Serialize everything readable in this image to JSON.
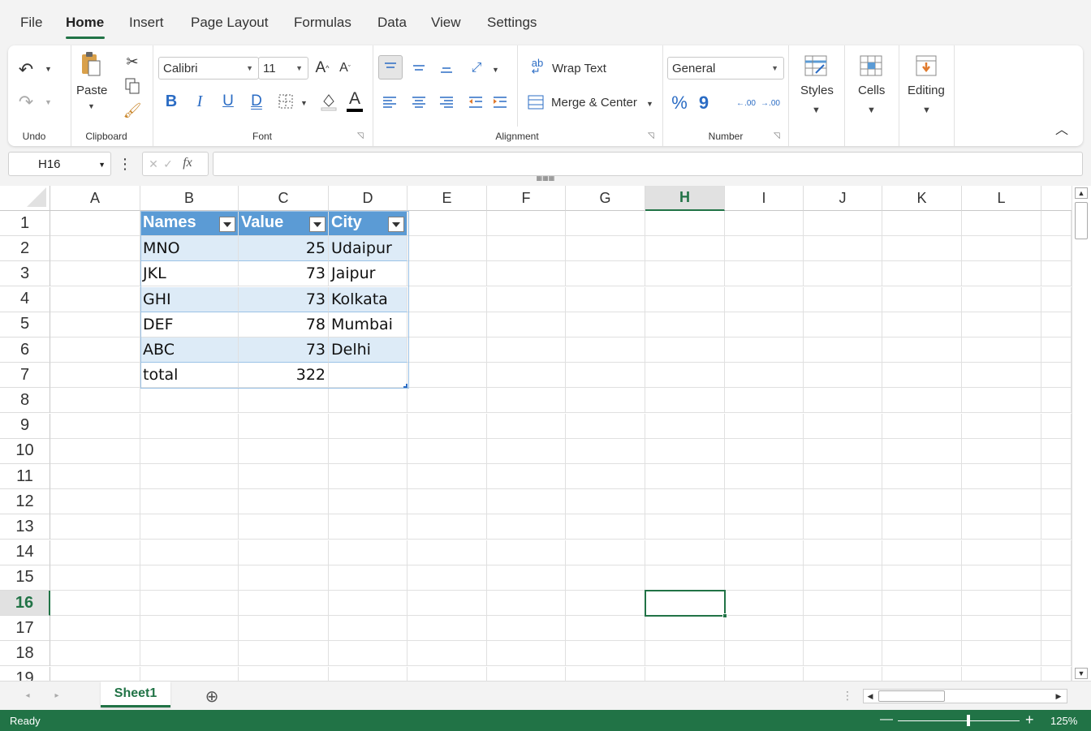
{
  "menu": {
    "tabs": [
      "File",
      "Home",
      "Insert",
      "Page Layout",
      "Formulas",
      "Data",
      "View",
      "Settings"
    ],
    "active": "Home"
  },
  "ribbon": {
    "undo_group": "Undo",
    "clipboard": {
      "paste": "Paste",
      "group": "Clipboard"
    },
    "font": {
      "family": "Calibri",
      "size": "11",
      "group": "Font",
      "bold": "B",
      "italic": "I",
      "underline": "U",
      "double_underline": "D",
      "grow": "A",
      "shrink": "A",
      "color": "A"
    },
    "alignment": {
      "wrap": "Wrap Text",
      "merge": "Merge & Center",
      "group": "Alignment"
    },
    "number": {
      "format": "General",
      "percent": "%",
      "comma": "9",
      "inc_dec": ".00",
      "group": "Number"
    },
    "styles": "Styles",
    "cells": "Cells",
    "editing": "Editing"
  },
  "formula_bar": {
    "name_box": "H16",
    "fx": "fx",
    "formula": ""
  },
  "columns": [
    "A",
    "B",
    "C",
    "D",
    "E",
    "F",
    "G",
    "H",
    "I",
    "J",
    "K",
    "L"
  ],
  "rows": [
    "1",
    "2",
    "3",
    "4",
    "5",
    "6",
    "7",
    "8",
    "9",
    "10",
    "11",
    "12",
    "13",
    "14",
    "15",
    "16",
    "17",
    "18",
    "19"
  ],
  "selected": {
    "column": "H",
    "row": "16"
  },
  "table": {
    "headers": [
      "Names",
      "Value",
      "City"
    ],
    "rows": [
      [
        "MNO",
        "25",
        "Udaipur"
      ],
      [
        "JKL",
        "73",
        "Jaipur"
      ],
      [
        "GHI",
        "73",
        "Kolkata"
      ],
      [
        "DEF",
        "78",
        "Mumbai"
      ],
      [
        "ABC",
        "73",
        "Delhi"
      ],
      [
        "total",
        "322",
        ""
      ]
    ]
  },
  "sheets": [
    "Sheet1"
  ],
  "status": {
    "text": "Ready",
    "zoom": "125%",
    "zoom_level": 1.25
  },
  "colors": {
    "accent": "#217346",
    "table_header": "#5b9bd5",
    "table_band": "#ddebf7"
  }
}
